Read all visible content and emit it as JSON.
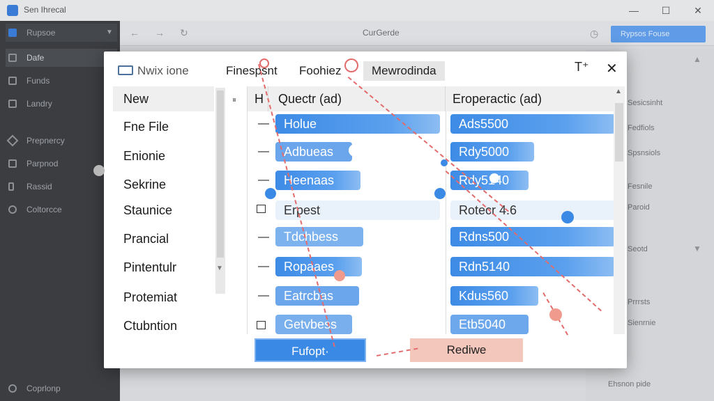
{
  "app": {
    "title": "Sen Ihrecal"
  },
  "window_controls": {
    "minimize": "—",
    "maximize": "☐",
    "close": "✕"
  },
  "sidebar": {
    "items": [
      {
        "label": "Rupsoe"
      },
      {
        "label": "Dafe"
      },
      {
        "label": "Funds"
      },
      {
        "label": "Landry"
      },
      {
        "label": "Prepnercy"
      },
      {
        "label": "Parpnod"
      },
      {
        "label": "Rassid"
      },
      {
        "label": "Coltorcce"
      },
      {
        "label": "Coprlonp"
      }
    ]
  },
  "toolbar": {
    "title": "CurGerde",
    "primary_button": "Rypsos Fouse"
  },
  "right_panel": {
    "items": [
      "Sesicsinht",
      "Fedfiols",
      "Spsnsiols",
      "Fesnile",
      "Paroid",
      "Seotd",
      "Prrrsts",
      "Sienrnie",
      "Ehsnon pide"
    ]
  },
  "dialog": {
    "tabs": [
      "Nwix ione",
      "Finespsnt",
      "Foohiez",
      "Mewrodinda"
    ],
    "controls": {
      "pin": "T⁺",
      "close": "✕"
    },
    "list": {
      "header": "New",
      "items": [
        "Fne File",
        "Enionie",
        "Sekrine",
        "Staunice",
        "Prancial",
        "Pintentulr",
        "Protemiat",
        "Ctubntion"
      ]
    },
    "grid": {
      "headers": [
        "H",
        "Quectr (ad)",
        "Eroperactic (ad)"
      ],
      "rows": [
        {
          "icon": "—",
          "col1": "Holue",
          "col2": "Ads5500"
        },
        {
          "icon": "—",
          "col1": "Adbueas",
          "col2": "Rdy5000"
        },
        {
          "icon": "—",
          "col1": "Heenaas",
          "col2": "Rdy5140"
        },
        {
          "icon": "☐",
          "col1": "Erpest",
          "col2": "Rotecr 4.6"
        },
        {
          "icon": "—",
          "col1": "Tdchbess",
          "col2": "Rdns500"
        },
        {
          "icon": "—",
          "col1": "Ropaaes",
          "col2": "Rdn5140"
        },
        {
          "icon": "—",
          "col1": "Eatrcbas",
          "col2": "Kdus560"
        },
        {
          "icon": "☐",
          "col1": "Getvbess",
          "col2": "Etb5040"
        }
      ]
    },
    "buttons": {
      "primary": "Fufopt·",
      "secondary": "Rediwe"
    }
  },
  "colors": {
    "accent": "#3a8ae5",
    "secondary_button": "#f4c7bd",
    "annotation": "#e36b6b",
    "sidebar": "#3b3d41"
  }
}
